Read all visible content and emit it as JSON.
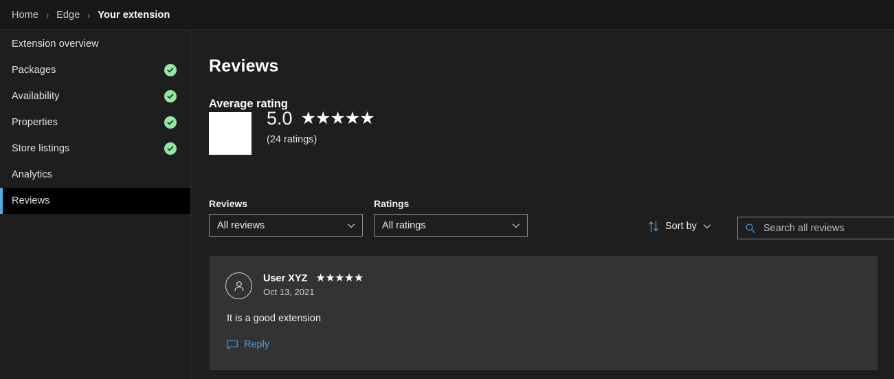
{
  "breadcrumb": {
    "items": [
      {
        "label": "Home",
        "current": false
      },
      {
        "label": "Edge",
        "current": false
      },
      {
        "label": "Your extension",
        "current": true
      }
    ],
    "separator": "›"
  },
  "sidebar": {
    "items": [
      {
        "label": "Extension overview",
        "complete": false,
        "selected": false
      },
      {
        "label": "Packages",
        "complete": true,
        "selected": false
      },
      {
        "label": "Availability",
        "complete": true,
        "selected": false
      },
      {
        "label": "Properties",
        "complete": true,
        "selected": false
      },
      {
        "label": "Store listings",
        "complete": true,
        "selected": false
      },
      {
        "label": "Analytics",
        "complete": false,
        "selected": false
      },
      {
        "label": "Reviews",
        "complete": false,
        "selected": true
      }
    ],
    "accent_color": "#5aa7dd",
    "complete_badge_color": "#92e8a0"
  },
  "main": {
    "page_title": "Reviews",
    "average_rating": {
      "section_title": "Average rating",
      "value": "5.0",
      "stars": "★★★★★",
      "count_text": "(24 ratings)"
    },
    "filters": {
      "reviews": {
        "label": "Reviews",
        "value": "All reviews"
      },
      "ratings": {
        "label": "Ratings",
        "value": "All ratings"
      },
      "sort": {
        "label": "Sort by"
      },
      "search": {
        "placeholder": "Search all reviews",
        "value": ""
      }
    },
    "reviews": [
      {
        "author": "User XYZ",
        "stars": "★★★★★",
        "date": "Oct 13, 2021",
        "body": "It is a good extension",
        "reply_label": "Reply"
      }
    ]
  },
  "colors": {
    "background": "#1e1e1e",
    "card": "#333333",
    "link": "#4a9fe0",
    "selected_item": "#000000"
  }
}
